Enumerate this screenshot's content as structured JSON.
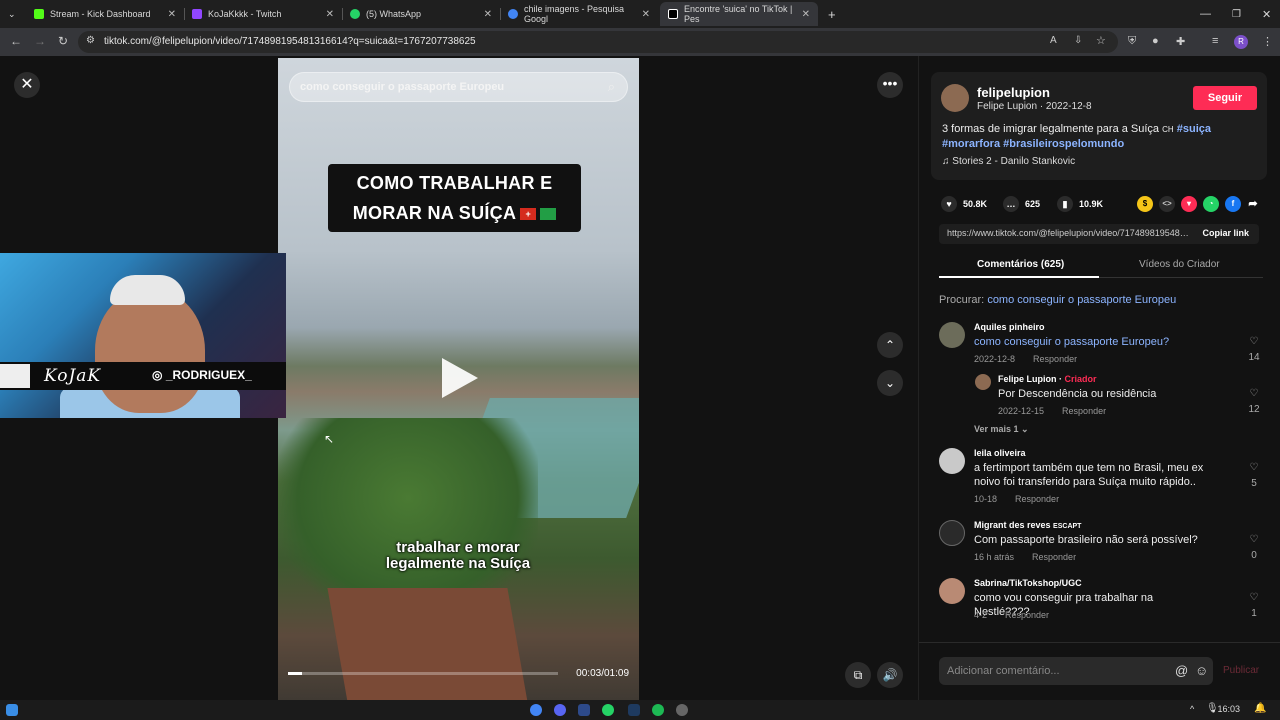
{
  "browser": {
    "tabs": [
      {
        "label": "Stream - Kick Dashboard",
        "color": "#53fc18"
      },
      {
        "label": "KoJaKkkk - Twitch",
        "color": "#9146ff"
      },
      {
        "label": "(5) WhatsApp",
        "color": "#25d366"
      },
      {
        "label": "chile imagens - Pesquisa Googl",
        "color": "#4285f4"
      },
      {
        "label": "Encontre 'suica' no TikTok | Pes",
        "color": "#ffffff"
      }
    ],
    "url": "tiktok.com/@felipelupion/video/7174898195481316614?q=suica&t=1767207738625"
  },
  "video": {
    "search_placeholder": "como conseguir o passaporte Europeu",
    "banner_line1": "COMO TRABALHAR E",
    "banner_line2": "MORAR NA SUÍÇA",
    "subtitle_line1": "trabalhar e morar",
    "subtitle_line2": "legalmente na Suíça",
    "time": "00:03/01:09",
    "progress": 0.05
  },
  "webcam": {
    "signature": "KoJaK",
    "instagram": "_RODRIGUEX_"
  },
  "post": {
    "username": "felipelupion",
    "subline": "Felipe Lupion · 2022-12-8",
    "follow_label": "Seguir",
    "desc_text": "3 formas de imigrar legalmente para a Suíça",
    "desc_ch": "CH",
    "tag1": "#suiça",
    "tag2": "#morarfora",
    "tag3": "#brasileirospelomundo",
    "music": "Stories 2 - Danilo Stankovic",
    "likes": "50.8K",
    "comments": "625",
    "saves": "10.9K",
    "link": "https://www.tiktok.com/@felipelupion/video/7174898195481316614",
    "copy_label": "Copiar link",
    "tab_comments": "Comentários (625)",
    "tab_videos": "Vídeos do Criador",
    "search_prefix": "Procurar:",
    "search_query": "como conseguir o passaporte Europeu"
  },
  "comments": [
    {
      "name": "Aquiles pinheiro",
      "text": "como conseguir o passaporte Europeu?",
      "date": "2022-12-8",
      "reply": "Responder",
      "likes": "14"
    },
    {
      "name": "Felipe Lupion",
      "badge": "Criador",
      "text": "Por Descendência ou residência",
      "date": "2022-12-15",
      "reply": "Responder",
      "likes": "12"
    },
    {
      "name": "leila oliveira",
      "text": "a fertimport também que tem no Brasil, meu ex noivo foi transferido para Suíça muito rápido..",
      "date": "10-18",
      "reply": "Responder",
      "likes": "5"
    },
    {
      "name": "Migrant des reves",
      "badge2": "ESCAPT",
      "text": "Com passaporte brasileiro não será possível?",
      "date": "16 h atrás",
      "reply": "Responder",
      "likes": "0"
    },
    {
      "name": "Sabrina/TikTokshop/UGC",
      "text": "como vou conseguir pra trabalhar na Nestlé????",
      "date": "4-2",
      "reply": "Responder",
      "likes": "1"
    }
  ],
  "ver_mais": "Ver mais 1",
  "composer": {
    "placeholder": "Adicionar comentário...",
    "publish": "Publicar"
  },
  "taskbar": {
    "time": "16:03"
  }
}
